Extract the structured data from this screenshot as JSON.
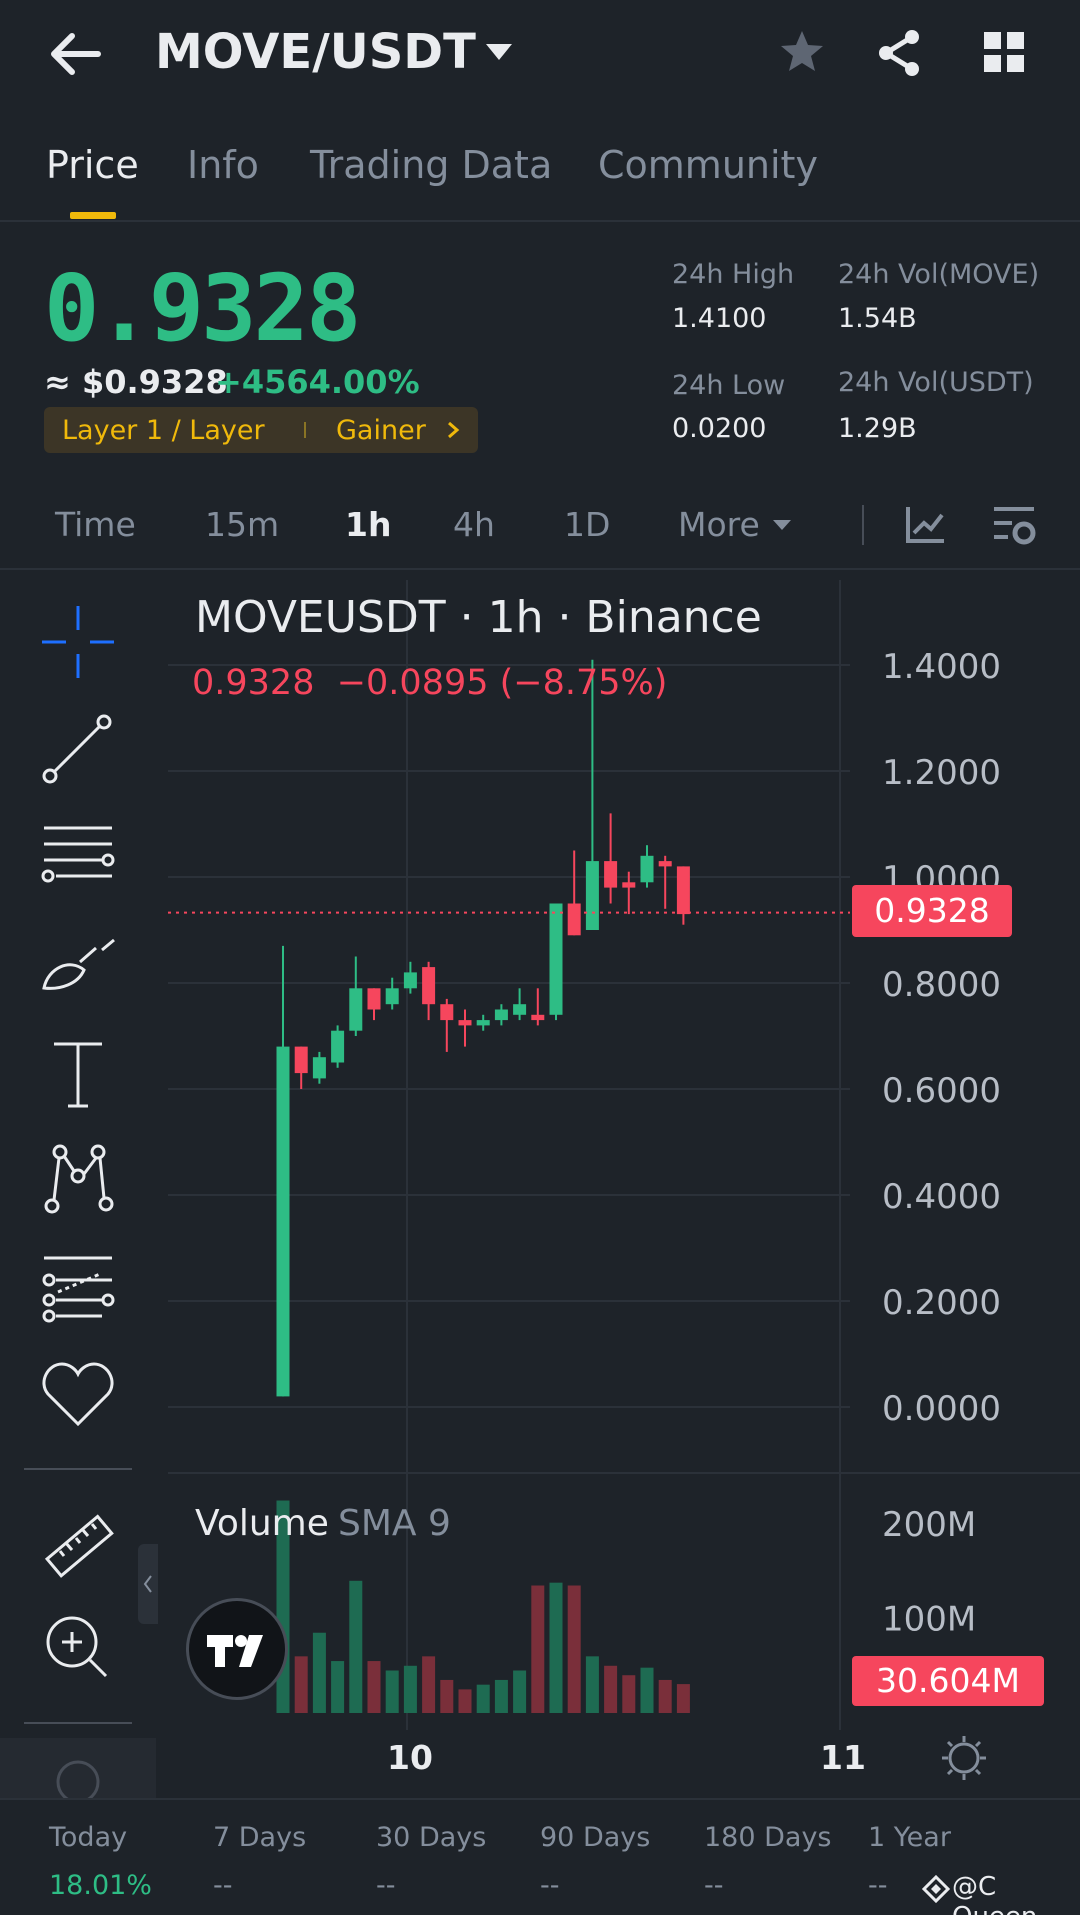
{
  "header": {
    "pair": "MOVE/USDT",
    "icons": [
      "back-arrow-icon",
      "dropdown-caret-icon",
      "star-icon",
      "share-icon",
      "grid-icon"
    ]
  },
  "tabs": [
    {
      "label": "Price",
      "active": true
    },
    {
      "label": "Info",
      "active": false
    },
    {
      "label": "Trading Data",
      "active": false
    },
    {
      "label": "Community",
      "active": false
    }
  ],
  "price": {
    "last": "0.9328",
    "usd": "≈ $0.9328",
    "change": "+4564.00%",
    "tag_left": "Layer 1 / Layer",
    "tag_right": "Gainer"
  },
  "stats": {
    "high_label": "24h High",
    "high_value": "1.4100",
    "low_label": "24h Low",
    "low_value": "0.0200",
    "vol_move_label": "24h Vol(MOVE)",
    "vol_move_value": "1.54B",
    "vol_usdt_label": "24h Vol(USDT)",
    "vol_usdt_value": "1.29B"
  },
  "intervals": [
    {
      "label": "Time",
      "active": false
    },
    {
      "label": "15m",
      "active": false
    },
    {
      "label": "1h",
      "active": true
    },
    {
      "label": "4h",
      "active": false
    },
    {
      "label": "1D",
      "active": false
    },
    {
      "label": "More",
      "active": false
    }
  ],
  "chart": {
    "symbol_line": "MOVEUSDT · 1h · Binance",
    "ohlc_line": "0.9328  −0.0895 (−8.75%)",
    "current_price_label": "0.9328",
    "volume_title": "Volume",
    "volume_sma": "SMA 9",
    "current_volume_label": "30.604M",
    "x_labels": [
      "10",
      "11"
    ],
    "colors": {
      "up": "#2ebd85",
      "down": "#f6465d",
      "up_vol": "#1e6b52",
      "down_vol": "#7a2f3a",
      "grid": "#2b3139"
    }
  },
  "chart_data": {
    "type": "candlestick",
    "title": "MOVEUSDT · 1h · Binance",
    "y_ticks": [
      "1.4000",
      "1.2000",
      "1.0000",
      "0.8000",
      "0.6000",
      "0.4000",
      "0.2000",
      "0.0000"
    ],
    "ylim": [
      0,
      1.4
    ],
    "candles": [
      {
        "o": 0.02,
        "h": 0.87,
        "l": 0.02,
        "c": 0.68
      },
      {
        "o": 0.68,
        "h": 0.68,
        "l": 0.6,
        "c": 0.63
      },
      {
        "o": 0.62,
        "h": 0.67,
        "l": 0.61,
        "c": 0.66
      },
      {
        "o": 0.65,
        "h": 0.72,
        "l": 0.64,
        "c": 0.71
      },
      {
        "o": 0.71,
        "h": 0.85,
        "l": 0.7,
        "c": 0.79
      },
      {
        "o": 0.79,
        "h": 0.79,
        "l": 0.73,
        "c": 0.75
      },
      {
        "o": 0.76,
        "h": 0.81,
        "l": 0.75,
        "c": 0.79
      },
      {
        "o": 0.79,
        "h": 0.84,
        "l": 0.78,
        "c": 0.82
      },
      {
        "o": 0.83,
        "h": 0.84,
        "l": 0.73,
        "c": 0.76
      },
      {
        "o": 0.76,
        "h": 0.77,
        "l": 0.67,
        "c": 0.73
      },
      {
        "o": 0.73,
        "h": 0.75,
        "l": 0.68,
        "c": 0.72
      },
      {
        "o": 0.72,
        "h": 0.74,
        "l": 0.71,
        "c": 0.73
      },
      {
        "o": 0.73,
        "h": 0.76,
        "l": 0.72,
        "c": 0.75
      },
      {
        "o": 0.74,
        "h": 0.79,
        "l": 0.73,
        "c": 0.76
      },
      {
        "o": 0.74,
        "h": 0.79,
        "l": 0.72,
        "c": 0.73
      },
      {
        "o": 0.74,
        "h": 0.95,
        "l": 0.73,
        "c": 0.95
      },
      {
        "o": 0.95,
        "h": 1.05,
        "l": 0.89,
        "c": 0.89
      },
      {
        "o": 0.9,
        "h": 1.41,
        "l": 0.9,
        "c": 1.03
      },
      {
        "o": 1.03,
        "h": 1.12,
        "l": 0.95,
        "c": 0.98
      },
      {
        "o": 0.99,
        "h": 1.01,
        "l": 0.93,
        "c": 0.98
      },
      {
        "o": 0.99,
        "h": 1.06,
        "l": 0.98,
        "c": 1.04
      },
      {
        "o": 1.03,
        "h": 1.04,
        "l": 0.94,
        "c": 1.02
      },
      {
        "o": 1.02,
        "h": 1.02,
        "l": 0.91,
        "c": 0.93
      }
    ],
    "volume_ticks": [
      "200M",
      "100M"
    ],
    "volumes": [
      225,
      60,
      85,
      55,
      140,
      55,
      45,
      50,
      60,
      35,
      25,
      30,
      35,
      45,
      135,
      138,
      135,
      60,
      50,
      40,
      48,
      35,
      30.6
    ]
  },
  "performance": [
    {
      "label": "Today",
      "value": "18.01%"
    },
    {
      "label": "7 Days",
      "value": "--"
    },
    {
      "label": "30 Days",
      "value": "--"
    },
    {
      "label": "90 Days",
      "value": "--"
    },
    {
      "label": "180 Days",
      "value": "--"
    },
    {
      "label": "1 Year",
      "value": "--"
    }
  ],
  "watermark": "@C Queen"
}
